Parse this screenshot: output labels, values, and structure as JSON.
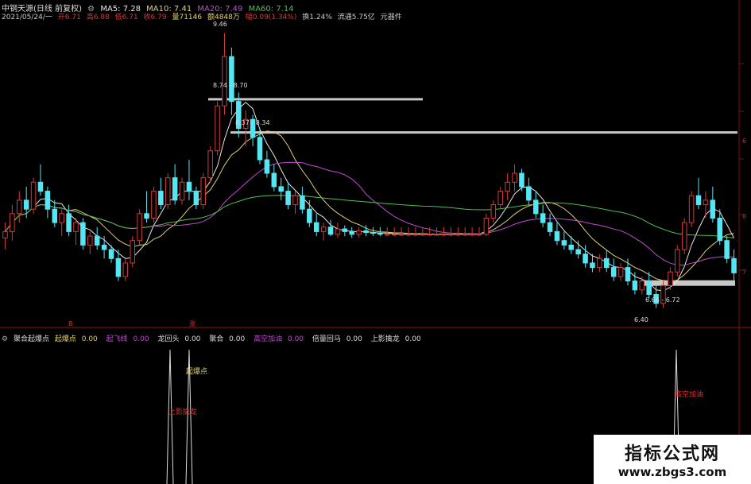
{
  "header": {
    "stock": "中钢天源(日线 前复权)",
    "ma5": "MA5: 7.28",
    "ma10": "MA10: 7.41",
    "ma20": "MA20: 7.49",
    "ma60": "MA60: 7.14",
    "date": "2021/05/24/一",
    "open": "开6.71",
    "high": "高6.88",
    "low": "低6.71",
    "close": "收6.79",
    "volume": "量71146",
    "amount": "额4848万",
    "change": "幅0.09(1.34%)",
    "turnover": "换1.24%",
    "float": "流通5.75亿",
    "unit": "元器件"
  },
  "indicator": {
    "name": "聚合起爆点",
    "items": [
      {
        "label": "起爆点",
        "value": "0.00"
      },
      {
        "label": "起飞线",
        "value": "0.00"
      },
      {
        "label": "龙回头",
        "value": "0.00"
      },
      {
        "label": "聚合",
        "value": "0.00"
      },
      {
        "label": "高空加油",
        "value": "0.00"
      },
      {
        "label": "倍量回马",
        "value": "0.00"
      },
      {
        "label": "上影擒龙",
        "value": "0.00"
      }
    ],
    "signal_labels": [
      "起爆点",
      "上影擒龙",
      "高空加油"
    ],
    "markers": [
      "B",
      "涨"
    ]
  },
  "price_labels": [
    "9.46",
    "8.74 - 8.70",
    "8.37 - 8.34",
    "6.66 - 6.72",
    "6.40"
  ],
  "right_axis": [
    "6",
    "8",
    "7"
  ],
  "colors": {
    "up": "#d23a3a",
    "down": "#54e6f2",
    "ma5": "#e6e6e6",
    "ma10": "#e0d070",
    "ma20": "#c04bd0",
    "ma60": "#4ec04a",
    "resist": "#c8c8c8",
    "grid": "#7a0f0f"
  },
  "watermark": {
    "title": "指标公式网",
    "url": "www.zbgs3.com"
  },
  "chart_data": {
    "type": "candlestick",
    "y_range": [
      6.2,
      9.6
    ],
    "candles": [
      [
        7.18,
        7.35,
        7.05,
        7.25
      ],
      [
        7.25,
        7.55,
        7.15,
        7.45
      ],
      [
        7.45,
        7.7,
        7.35,
        7.6
      ],
      [
        7.6,
        7.75,
        7.4,
        7.5
      ],
      [
        7.5,
        7.85,
        7.45,
        7.8
      ],
      [
        7.8,
        8.0,
        7.65,
        7.7
      ],
      [
        7.7,
        7.75,
        7.4,
        7.5
      ],
      [
        7.5,
        7.6,
        7.3,
        7.35
      ],
      [
        7.35,
        7.5,
        7.2,
        7.45
      ],
      [
        7.45,
        7.55,
        7.2,
        7.25
      ],
      [
        7.25,
        7.4,
        7.1,
        7.35
      ],
      [
        7.35,
        7.4,
        7.05,
        7.1
      ],
      [
        7.1,
        7.25,
        7.0,
        7.2
      ],
      [
        7.2,
        7.3,
        7.05,
        7.1
      ],
      [
        7.1,
        7.2,
        6.95,
        7.05
      ],
      [
        7.05,
        7.1,
        6.9,
        6.95
      ],
      [
        6.95,
        7.05,
        6.7,
        6.75
      ],
      [
        6.75,
        6.95,
        6.7,
        6.9
      ],
      [
        6.9,
        7.2,
        6.85,
        7.15
      ],
      [
        7.15,
        7.5,
        7.1,
        7.45
      ],
      [
        7.45,
        7.7,
        7.35,
        7.4
      ],
      [
        7.4,
        7.75,
        7.35,
        7.7
      ],
      [
        7.7,
        7.85,
        7.5,
        7.55
      ],
      [
        7.55,
        7.9,
        7.5,
        7.85
      ],
      [
        7.85,
        8.0,
        7.55,
        7.6
      ],
      [
        7.6,
        7.85,
        7.55,
        7.8
      ],
      [
        7.8,
        8.05,
        7.6,
        7.7
      ],
      [
        7.7,
        7.75,
        7.5,
        7.55
      ],
      [
        7.55,
        7.9,
        7.5,
        7.85
      ],
      [
        7.85,
        8.2,
        7.8,
        8.15
      ],
      [
        8.15,
        8.7,
        8.1,
        8.65
      ],
      [
        8.65,
        9.46,
        8.55,
        9.2
      ],
      [
        9.2,
        9.3,
        8.55,
        8.7
      ],
      [
        8.7,
        8.8,
        8.3,
        8.4
      ],
      [
        8.4,
        8.6,
        8.2,
        8.5
      ],
      [
        8.5,
        8.55,
        8.2,
        8.3
      ],
      [
        8.3,
        8.4,
        8.0,
        8.05
      ],
      [
        8.05,
        8.15,
        7.85,
        7.9
      ],
      [
        7.9,
        8.0,
        7.7,
        7.75
      ],
      [
        7.75,
        7.85,
        7.6,
        7.7
      ],
      [
        7.7,
        7.8,
        7.5,
        7.55
      ],
      [
        7.55,
        7.7,
        7.45,
        7.65
      ],
      [
        7.65,
        7.75,
        7.45,
        7.5
      ],
      [
        7.5,
        7.6,
        7.3,
        7.35
      ],
      [
        7.35,
        7.45,
        7.2,
        7.25
      ],
      [
        7.25,
        7.35,
        7.15,
        7.3
      ],
      [
        7.3,
        7.38,
        7.2,
        7.22
      ],
      [
        7.22,
        7.35,
        7.18,
        7.28
      ],
      [
        7.28,
        7.32,
        7.2,
        7.25
      ],
      [
        7.25,
        7.3,
        7.18,
        7.22
      ],
      [
        7.22,
        7.3,
        7.18,
        7.26
      ],
      [
        7.26,
        7.32,
        7.2,
        7.24
      ],
      [
        7.24,
        7.3,
        7.2,
        7.23
      ],
      [
        7.23,
        7.3,
        7.2,
        7.22
      ],
      [
        7.22,
        7.3,
        7.2,
        7.22
      ],
      [
        7.22,
        7.3,
        7.2,
        7.22
      ],
      [
        7.22,
        7.3,
        7.2,
        7.22
      ],
      [
        7.22,
        7.3,
        7.2,
        7.22
      ],
      [
        7.22,
        7.3,
        7.2,
        7.22
      ],
      [
        7.22,
        7.3,
        7.2,
        7.22
      ],
      [
        7.22,
        7.3,
        7.2,
        7.22
      ],
      [
        7.22,
        7.3,
        7.2,
        7.22
      ],
      [
        7.22,
        7.3,
        7.2,
        7.22
      ],
      [
        7.22,
        7.3,
        7.2,
        7.22
      ],
      [
        7.22,
        7.3,
        7.2,
        7.22
      ],
      [
        7.22,
        7.3,
        7.2,
        7.22
      ],
      [
        7.22,
        7.3,
        7.2,
        7.22
      ],
      [
        7.22,
        7.3,
        7.2,
        7.22
      ],
      [
        7.22,
        7.45,
        7.2,
        7.4
      ],
      [
        7.4,
        7.6,
        7.35,
        7.55
      ],
      [
        7.55,
        7.75,
        7.5,
        7.7
      ],
      [
        7.7,
        7.9,
        7.6,
        7.8
      ],
      [
        7.8,
        8.0,
        7.7,
        7.9
      ],
      [
        7.9,
        7.95,
        7.7,
        7.75
      ],
      [
        7.75,
        7.85,
        7.55,
        7.6
      ],
      [
        7.6,
        7.7,
        7.4,
        7.45
      ],
      [
        7.45,
        7.55,
        7.3,
        7.35
      ],
      [
        7.35,
        7.45,
        7.2,
        7.25
      ],
      [
        7.25,
        7.35,
        7.1,
        7.15
      ],
      [
        7.15,
        7.25,
        7.05,
        7.1
      ],
      [
        7.1,
        7.2,
        7.0,
        7.05
      ],
      [
        7.05,
        7.15,
        6.95,
        7.0
      ],
      [
        7.0,
        7.1,
        6.85,
        6.9
      ],
      [
        6.9,
        7.0,
        6.8,
        6.85
      ],
      [
        6.85,
        7.0,
        6.8,
        6.95
      ],
      [
        6.95,
        7.05,
        6.8,
        6.85
      ],
      [
        6.85,
        6.95,
        6.7,
        6.75
      ],
      [
        6.75,
        6.9,
        6.7,
        6.85
      ],
      [
        6.85,
        6.95,
        6.65,
        6.7
      ],
      [
        6.7,
        6.8,
        6.55,
        6.6
      ],
      [
        6.6,
        6.75,
        6.55,
        6.7
      ],
      [
        6.7,
        6.8,
        6.5,
        6.55
      ],
      [
        6.55,
        6.65,
        6.4,
        6.45
      ],
      [
        6.45,
        6.7,
        6.4,
        6.65
      ],
      [
        6.65,
        6.85,
        6.6,
        6.8
      ],
      [
        6.8,
        7.1,
        6.75,
        7.05
      ],
      [
        7.05,
        7.4,
        7.0,
        7.35
      ],
      [
        7.35,
        7.7,
        7.3,
        7.65
      ],
      [
        7.65,
        7.85,
        7.5,
        7.55
      ],
      [
        7.55,
        7.7,
        7.4,
        7.6
      ],
      [
        7.6,
        7.75,
        7.35,
        7.4
      ],
      [
        7.4,
        7.5,
        7.1,
        7.15
      ],
      [
        7.15,
        7.2,
        6.9,
        6.95
      ],
      [
        6.95,
        7.05,
        6.71,
        6.79
      ]
    ],
    "resistance": [
      8.72,
      8.35,
      6.69
    ],
    "signal_spikes": [
      42,
      48,
      158
    ]
  }
}
